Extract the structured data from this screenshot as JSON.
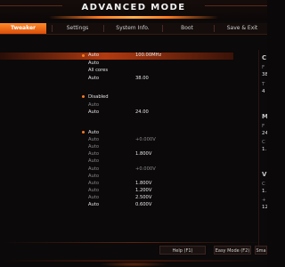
{
  "header": {
    "title": "ADVANCED MODE"
  },
  "tabs": [
    {
      "label": "Tweaker",
      "active": true
    },
    {
      "label": "Settings",
      "active": false
    },
    {
      "label": "System Info.",
      "active": false
    },
    {
      "label": "Boot",
      "active": false
    },
    {
      "label": "Save & Exit",
      "active": false
    }
  ],
  "settings": {
    "values": [
      "Auto",
      "Auto",
      "All cores",
      "Auto",
      "Disabled",
      "Auto",
      "Auto",
      "Auto",
      "Auto",
      "Auto",
      "Auto",
      "Auto",
      "Auto",
      "Auto",
      "Auto",
      "Auto",
      "Auto",
      "Auto"
    ],
    "readouts": {
      "base_clock": "100.00MHz",
      "ratio": "38.00",
      "ratio2": "24.00",
      "v0": "+0.000V",
      "v1": "1.800V",
      "v2": "+0.000V",
      "v3": "1.800V",
      "v4": "1.200V",
      "v5": "2.500V",
      "v6": "0.600V"
    }
  },
  "right_panel": {
    "ch1": "C",
    "l1": "F",
    "v1": "38",
    "l2": "T",
    "v2": "4",
    "ch2": "M",
    "l3": "F",
    "v3": "24",
    "l4": "C",
    "v4": "1.",
    "ch3": "V",
    "l5": "C",
    "v5": "1.",
    "l6": "+",
    "v6": "12"
  },
  "footer": {
    "help_label": "Help (F1)",
    "easy_label": "Easy Mode (F2)",
    "smart_label": "Sma"
  },
  "colors": {
    "accent": "#ff7a1e",
    "tab_active": "#e0621a",
    "background": "#0b0909"
  }
}
